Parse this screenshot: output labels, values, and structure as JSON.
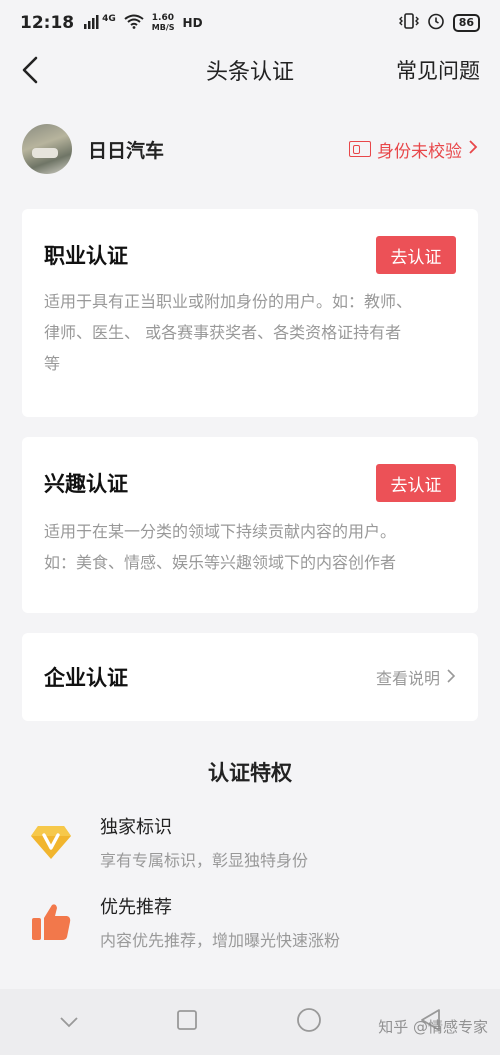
{
  "status": {
    "time": "12:18",
    "network": "4G",
    "speed_value": "1.60",
    "speed_unit": "MB/S",
    "hd": "HD",
    "battery": "86"
  },
  "nav": {
    "title": "头条认证",
    "faq": "常见问题"
  },
  "profile": {
    "name": "日日汽车",
    "verify_text": "身份未校验"
  },
  "cards": {
    "professional": {
      "title": "职业认证",
      "button": "去认证",
      "desc_lines": [
        "适用于具有正当职业或附加身份的用户。如：教师、",
        "律师、医生、 或各赛事获奖者、各类资格证持有者",
        "等"
      ]
    },
    "interest": {
      "title": "兴趣认证",
      "button": "去认证",
      "desc_lines": [
        "适用于在某一分类的领域下持续贡献内容的用户。",
        "如：美食、情感、娱乐等兴趣领域下的内容创作者"
      ]
    },
    "enterprise": {
      "title": "企业认证",
      "link": "查看说明"
    }
  },
  "privileges": {
    "title": "认证特权",
    "items": [
      {
        "title": "独家标识",
        "desc": "享有专属标识，彰显独特身份",
        "icon": "diamond-v-icon"
      },
      {
        "title": "优先推荐",
        "desc": "内容优先推荐，增加曝光快速涨粉",
        "icon": "thumbs-up-icon"
      }
    ]
  },
  "watermark": "知乎 @情感专家",
  "colors": {
    "accent": "#ec5157",
    "link_red": "#e8474a",
    "gold": "#f1b52e",
    "orange": "#f2784b"
  }
}
